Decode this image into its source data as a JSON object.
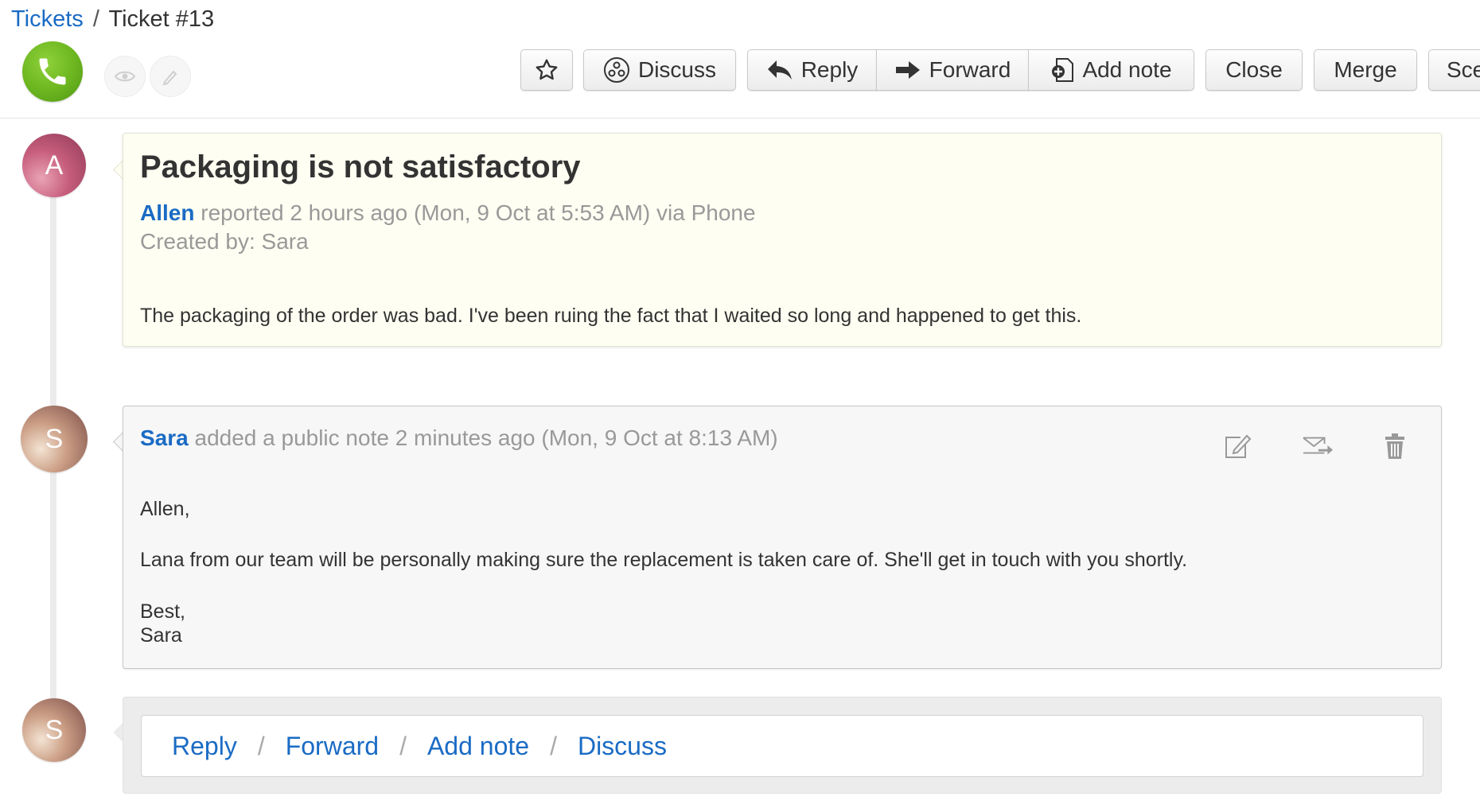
{
  "breadcrumb": {
    "parent": "Tickets",
    "separator": "/",
    "current": "Ticket #13"
  },
  "toolbar": {
    "discuss": "Discuss",
    "reply": "Reply",
    "forward": "Forward",
    "add_note": "Add note",
    "close": "Close",
    "merge": "Merge",
    "scenario_partial": "Sce"
  },
  "ticket": {
    "title": "Packaging is not satisfactory",
    "requester": "Allen",
    "reported_text": "reported 2 hours ago (Mon, 9 Oct at 5:53 AM) via Phone",
    "created_by": "Created by: Sara",
    "description": "The packaging of the order was bad. I've been ruing the fact that I waited so long and happened to get this.",
    "avatar_letter": "A"
  },
  "note": {
    "author": "Sara",
    "meta_text": "added a public note 2 minutes ago (Mon, 9 Oct at 8:13 AM)",
    "avatar_letter": "S",
    "lines": [
      "Allen,",
      "Lana from our team will be personally making sure the replacement is taken care of. She'll get in touch with you shortly.",
      "Best,",
      "Sara"
    ]
  },
  "reply_bar": {
    "avatar_letter": "S",
    "reply": "Reply",
    "forward": "Forward",
    "add_note": "Add note",
    "discuss": "Discuss",
    "separator": "/"
  },
  "colors": {
    "link": "#1a6bc4",
    "ticket_bg": "#fefef2",
    "note_bg": "#f7f7f7",
    "source_green": "#6bb51f"
  },
  "icons": {
    "source": "phone-icon",
    "watch": "eye-icon",
    "edit": "pencil-icon",
    "favorite": "star-icon",
    "discuss": "discuss-icon",
    "reply": "reply-arrow-icon",
    "forward": "forward-arrow-icon",
    "add_note": "add-note-icon",
    "note_edit": "edit-icon",
    "note_forward": "mail-forward-icon",
    "note_delete": "trash-icon"
  }
}
